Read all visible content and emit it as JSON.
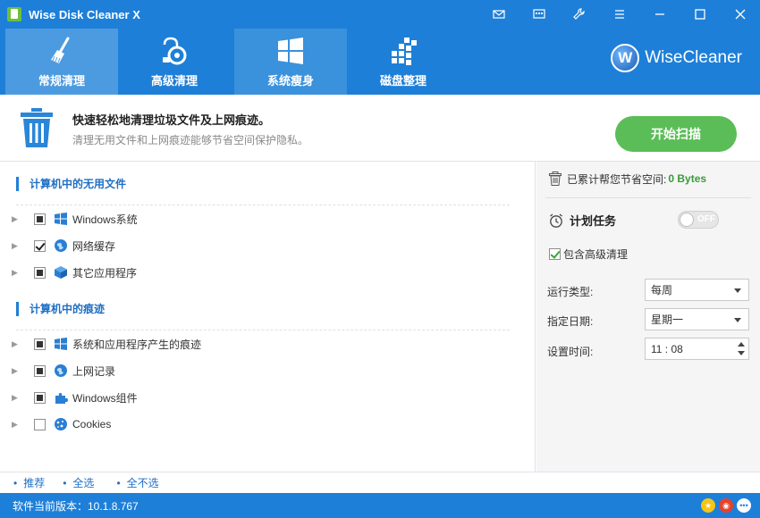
{
  "window": {
    "title": "Wise Disk Cleaner X"
  },
  "tabs": [
    {
      "label": "常规清理",
      "icon": "broom-icon"
    },
    {
      "label": "高级清理",
      "icon": "vacuum-icon"
    },
    {
      "label": "系统瘦身",
      "icon": "windows-icon"
    },
    {
      "label": "磁盘整理",
      "icon": "defrag-icon"
    }
  ],
  "brand": {
    "logo_letter": "W",
    "name": "WiseCleaner"
  },
  "banner": {
    "headline": "快速轻松地清理垃圾文件及上网痕迹。",
    "subline": "清理无用文件和上网痕迹能够节省空间保护隐私。",
    "scan_button": "开始扫描"
  },
  "sections": [
    {
      "title": "计算机中的无用文件",
      "items": [
        {
          "label": "Windows系统",
          "check": "partial",
          "icon": "windows-logo-icon"
        },
        {
          "label": "网络缓存",
          "check": "checked",
          "icon": "globe-icon"
        },
        {
          "label": "其它应用程序",
          "check": "partial",
          "icon": "app-box-icon"
        }
      ]
    },
    {
      "title": "计算机中的痕迹",
      "items": [
        {
          "label": "系统和应用程序产生的痕迹",
          "check": "partial",
          "icon": "windows-logo-icon"
        },
        {
          "label": "上网记录",
          "check": "partial",
          "icon": "globe-icon"
        },
        {
          "label": "Windows组件",
          "check": "partial",
          "icon": "puzzle-icon"
        },
        {
          "label": "Cookies",
          "check": "unchecked",
          "icon": "cookie-icon"
        }
      ]
    }
  ],
  "right": {
    "saved_label": "已累计帮您节省空间:",
    "saved_value": "0 Bytes",
    "schedule_label": "计划任务",
    "toggle_state": "OFF",
    "include_advanced": "包含高级清理",
    "run_type_label": "运行类型:",
    "run_type_value": "每周",
    "date_label": "指定日期:",
    "date_value": "星期一",
    "time_label": "设置时间:",
    "time_value": "11 : 08"
  },
  "footer": {
    "links": [
      "推荐",
      "全选",
      "全不选"
    ]
  },
  "status": {
    "version_text": "软件当前版本：10.1.8.767"
  },
  "colors": {
    "primary": "#1e7fd8",
    "accent_green": "#5bbd57",
    "link": "#1e6fc4"
  }
}
